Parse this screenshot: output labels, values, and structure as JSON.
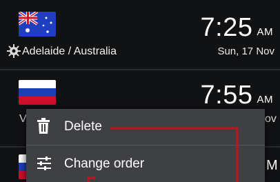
{
  "clocks": [
    {
      "country_flag": "australia-flag-icon",
      "time": "7:25",
      "ampm": "AM",
      "city": "Adelaide / Australia",
      "date": "Sun, 17 Nov"
    },
    {
      "country_flag": "russia-flag-icon",
      "time": "7:55",
      "ampm": "AM",
      "city_partial": "V",
      "date_partial": "ov"
    },
    {
      "country_flag": "russia-flag-icon",
      "time_partial": "M"
    }
  ],
  "context_menu": {
    "items": [
      {
        "label": "Delete",
        "icon": "trash-icon"
      },
      {
        "label": "Change order",
        "icon": "sliders-icon"
      }
    ]
  },
  "colors": {
    "callout": "#c0141c",
    "menu_bg": "#3e4044",
    "row_bg": "#111214"
  }
}
